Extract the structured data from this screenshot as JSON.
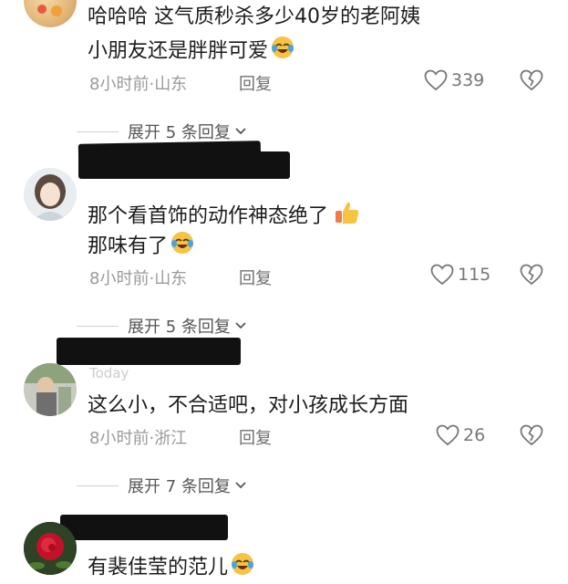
{
  "comments": [
    {
      "lines": [
        "哈哈哈 这气质秒杀多少40岁的老阿姨",
        "小朋友还是胖胖可爱"
      ],
      "time": "8小时前",
      "location": "山东",
      "reply_label": "回复",
      "likes": "339",
      "expand_label": "展开 5 条回复"
    },
    {
      "lines": [
        "那个看首饰的动作神态绝了",
        "那味有了"
      ],
      "time": "8小时前",
      "location": "山东",
      "reply_label": "回复",
      "likes": "115",
      "expand_label": "展开 5 条回复"
    },
    {
      "ghost_name": "Today",
      "lines": [
        "这么小，不合适吧，对小孩成长方面"
      ],
      "time": "8小时前",
      "location": "浙江",
      "reply_label": "回复",
      "likes": "26",
      "expand_label": "展开 7 条回复"
    },
    {
      "lines": [
        "有裴佳莹的范儿"
      ]
    }
  ],
  "separator": "·",
  "colors": {
    "text": "#1c1c1c",
    "meta": "#9a9a9a",
    "redaction": "#111111",
    "emoji_yellow": "#f6c343"
  },
  "icons": [
    "heart-outline-icon",
    "broken-heart-icon",
    "chevron-down-icon",
    "laughing-tears-emoji",
    "thumbs-up-emoji"
  ]
}
